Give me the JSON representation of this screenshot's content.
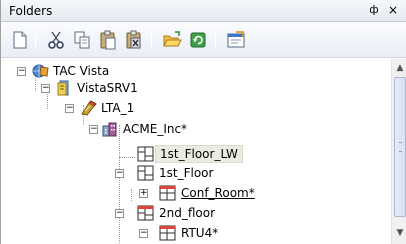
{
  "panel": {
    "title": "Folders",
    "pin_glyph": "ф",
    "close_glyph": "×"
  },
  "toolbar": {
    "buttons": [
      {
        "name": "new-document-icon"
      },
      {
        "name": "cut-icon"
      },
      {
        "name": "copy-icon"
      },
      {
        "name": "paste-icon"
      },
      {
        "name": "delete-icon"
      },
      {
        "name": "open-folder-icon"
      },
      {
        "name": "refresh-icon"
      },
      {
        "name": "properties-icon"
      }
    ]
  },
  "tree": {
    "nodes": [
      {
        "label": "TAC Vista",
        "icon": "globe-server-icon",
        "expander": "−"
      },
      {
        "label": "VistaSRV1",
        "icon": "server-icon",
        "expander": "−"
      },
      {
        "label": "LTA_1",
        "icon": "device-icon",
        "expander": "−"
      },
      {
        "label": "ACME_Inc*",
        "icon": "building-icon",
        "expander": "−"
      },
      {
        "label": "1st_Floor_LW",
        "icon": "floor-plan-icon",
        "expander": ""
      },
      {
        "label": "1st_Floor",
        "icon": "floor-plan-icon",
        "expander": "−"
      },
      {
        "label": "Conf_Room*",
        "icon": "room-icon",
        "expander": "+"
      },
      {
        "label": "2nd_floor",
        "icon": "floor-plan-icon",
        "expander": "−"
      },
      {
        "label": "RTU4*",
        "icon": "room-icon",
        "expander": "−"
      }
    ]
  },
  "scrollbar": {
    "up_glyph": "▲",
    "down_glyph": "▼"
  }
}
